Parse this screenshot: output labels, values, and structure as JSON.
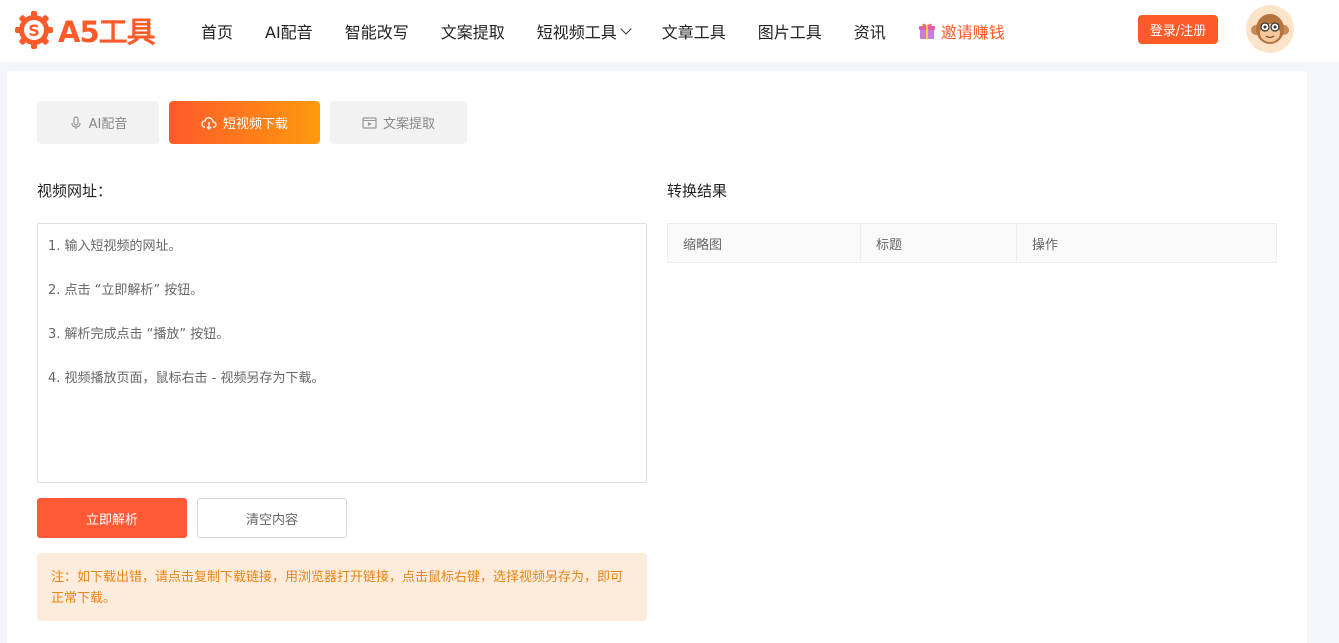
{
  "brand": {
    "logo_text": "A5工具",
    "accent": "#ff5a2a"
  },
  "nav": {
    "items": [
      {
        "label": "首页"
      },
      {
        "label": "AI配音"
      },
      {
        "label": "智能改写"
      },
      {
        "label": "文案提取"
      },
      {
        "label": "短视频工具",
        "has_dropdown": true
      },
      {
        "label": "文章工具"
      },
      {
        "label": "图片工具"
      },
      {
        "label": "资讯"
      }
    ],
    "invite_label": "邀请赚钱",
    "login_label": "登录/注册"
  },
  "tabs": [
    {
      "label": "AI配音",
      "icon": "microphone-icon",
      "active": false
    },
    {
      "label": "短视频下载",
      "icon": "cloud-download-icon",
      "active": true
    },
    {
      "label": "文案提取",
      "icon": "video-text-icon",
      "active": false
    }
  ],
  "form": {
    "url_label": "视频网址：",
    "instructions": [
      "1. 输入短视频的网址。",
      "2. 点击 “立即解析” 按钮。",
      "3. 解析完成点击 “播放” 按钮。",
      "4. 视频播放页面，鼠标右击 - 视频另存为下载。"
    ],
    "parse_label": "立即解析",
    "clear_label": "清空内容",
    "note": "注：如下载出错，请点击复制下载链接，用浏览器打开链接，点击鼠标右键，选择视频另存为，即可正常下载。"
  },
  "result": {
    "title": "转换结果",
    "columns": [
      "缩略图",
      "标题",
      "操作"
    ]
  }
}
